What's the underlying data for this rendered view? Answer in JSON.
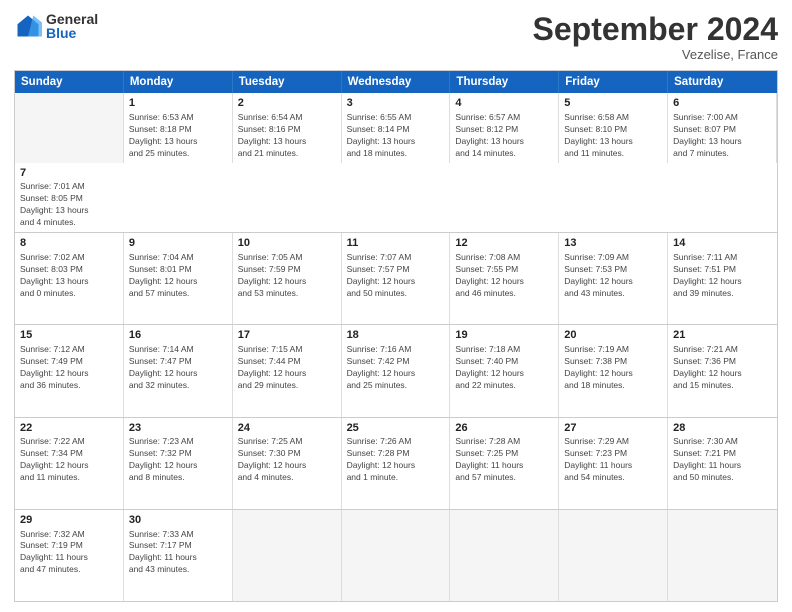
{
  "logo": {
    "general": "General",
    "blue": "Blue"
  },
  "title": "September 2024",
  "location": "Vezelise, France",
  "days": [
    "Sunday",
    "Monday",
    "Tuesday",
    "Wednesday",
    "Thursday",
    "Friday",
    "Saturday"
  ],
  "rows": [
    [
      {
        "day": "",
        "empty": true
      },
      {
        "day": "1",
        "line1": "Sunrise: 6:53 AM",
        "line2": "Sunset: 8:18 PM",
        "line3": "Daylight: 13 hours",
        "line4": "and 25 minutes."
      },
      {
        "day": "2",
        "line1": "Sunrise: 6:54 AM",
        "line2": "Sunset: 8:16 PM",
        "line3": "Daylight: 13 hours",
        "line4": "and 21 minutes."
      },
      {
        "day": "3",
        "line1": "Sunrise: 6:55 AM",
        "line2": "Sunset: 8:14 PM",
        "line3": "Daylight: 13 hours",
        "line4": "and 18 minutes."
      },
      {
        "day": "4",
        "line1": "Sunrise: 6:57 AM",
        "line2": "Sunset: 8:12 PM",
        "line3": "Daylight: 13 hours",
        "line4": "and 14 minutes."
      },
      {
        "day": "5",
        "line1": "Sunrise: 6:58 AM",
        "line2": "Sunset: 8:10 PM",
        "line3": "Daylight: 13 hours",
        "line4": "and 11 minutes."
      },
      {
        "day": "6",
        "line1": "Sunrise: 7:00 AM",
        "line2": "Sunset: 8:07 PM",
        "line3": "Daylight: 13 hours",
        "line4": "and 7 minutes."
      },
      {
        "day": "7",
        "line1": "Sunrise: 7:01 AM",
        "line2": "Sunset: 8:05 PM",
        "line3": "Daylight: 13 hours",
        "line4": "and 4 minutes."
      }
    ],
    [
      {
        "day": "8",
        "line1": "Sunrise: 7:02 AM",
        "line2": "Sunset: 8:03 PM",
        "line3": "Daylight: 13 hours",
        "line4": "and 0 minutes."
      },
      {
        "day": "9",
        "line1": "Sunrise: 7:04 AM",
        "line2": "Sunset: 8:01 PM",
        "line3": "Daylight: 12 hours",
        "line4": "and 57 minutes."
      },
      {
        "day": "10",
        "line1": "Sunrise: 7:05 AM",
        "line2": "Sunset: 7:59 PM",
        "line3": "Daylight: 12 hours",
        "line4": "and 53 minutes."
      },
      {
        "day": "11",
        "line1": "Sunrise: 7:07 AM",
        "line2": "Sunset: 7:57 PM",
        "line3": "Daylight: 12 hours",
        "line4": "and 50 minutes."
      },
      {
        "day": "12",
        "line1": "Sunrise: 7:08 AM",
        "line2": "Sunset: 7:55 PM",
        "line3": "Daylight: 12 hours",
        "line4": "and 46 minutes."
      },
      {
        "day": "13",
        "line1": "Sunrise: 7:09 AM",
        "line2": "Sunset: 7:53 PM",
        "line3": "Daylight: 12 hours",
        "line4": "and 43 minutes."
      },
      {
        "day": "14",
        "line1": "Sunrise: 7:11 AM",
        "line2": "Sunset: 7:51 PM",
        "line3": "Daylight: 12 hours",
        "line4": "and 39 minutes."
      }
    ],
    [
      {
        "day": "15",
        "line1": "Sunrise: 7:12 AM",
        "line2": "Sunset: 7:49 PM",
        "line3": "Daylight: 12 hours",
        "line4": "and 36 minutes."
      },
      {
        "day": "16",
        "line1": "Sunrise: 7:14 AM",
        "line2": "Sunset: 7:47 PM",
        "line3": "Daylight: 12 hours",
        "line4": "and 32 minutes."
      },
      {
        "day": "17",
        "line1": "Sunrise: 7:15 AM",
        "line2": "Sunset: 7:44 PM",
        "line3": "Daylight: 12 hours",
        "line4": "and 29 minutes."
      },
      {
        "day": "18",
        "line1": "Sunrise: 7:16 AM",
        "line2": "Sunset: 7:42 PM",
        "line3": "Daylight: 12 hours",
        "line4": "and 25 minutes."
      },
      {
        "day": "19",
        "line1": "Sunrise: 7:18 AM",
        "line2": "Sunset: 7:40 PM",
        "line3": "Daylight: 12 hours",
        "line4": "and 22 minutes."
      },
      {
        "day": "20",
        "line1": "Sunrise: 7:19 AM",
        "line2": "Sunset: 7:38 PM",
        "line3": "Daylight: 12 hours",
        "line4": "and 18 minutes."
      },
      {
        "day": "21",
        "line1": "Sunrise: 7:21 AM",
        "line2": "Sunset: 7:36 PM",
        "line3": "Daylight: 12 hours",
        "line4": "and 15 minutes."
      }
    ],
    [
      {
        "day": "22",
        "line1": "Sunrise: 7:22 AM",
        "line2": "Sunset: 7:34 PM",
        "line3": "Daylight: 12 hours",
        "line4": "and 11 minutes."
      },
      {
        "day": "23",
        "line1": "Sunrise: 7:23 AM",
        "line2": "Sunset: 7:32 PM",
        "line3": "Daylight: 12 hours",
        "line4": "and 8 minutes."
      },
      {
        "day": "24",
        "line1": "Sunrise: 7:25 AM",
        "line2": "Sunset: 7:30 PM",
        "line3": "Daylight: 12 hours",
        "line4": "and 4 minutes."
      },
      {
        "day": "25",
        "line1": "Sunrise: 7:26 AM",
        "line2": "Sunset: 7:28 PM",
        "line3": "Daylight: 12 hours",
        "line4": "and 1 minute."
      },
      {
        "day": "26",
        "line1": "Sunrise: 7:28 AM",
        "line2": "Sunset: 7:25 PM",
        "line3": "Daylight: 11 hours",
        "line4": "and 57 minutes."
      },
      {
        "day": "27",
        "line1": "Sunrise: 7:29 AM",
        "line2": "Sunset: 7:23 PM",
        "line3": "Daylight: 11 hours",
        "line4": "and 54 minutes."
      },
      {
        "day": "28",
        "line1": "Sunrise: 7:30 AM",
        "line2": "Sunset: 7:21 PM",
        "line3": "Daylight: 11 hours",
        "line4": "and 50 minutes."
      }
    ],
    [
      {
        "day": "29",
        "line1": "Sunrise: 7:32 AM",
        "line2": "Sunset: 7:19 PM",
        "line3": "Daylight: 11 hours",
        "line4": "and 47 minutes."
      },
      {
        "day": "30",
        "line1": "Sunrise: 7:33 AM",
        "line2": "Sunset: 7:17 PM",
        "line3": "Daylight: 11 hours",
        "line4": "and 43 minutes."
      },
      {
        "day": "",
        "empty": true
      },
      {
        "day": "",
        "empty": true
      },
      {
        "day": "",
        "empty": true
      },
      {
        "day": "",
        "empty": true
      },
      {
        "day": "",
        "empty": true
      }
    ]
  ]
}
